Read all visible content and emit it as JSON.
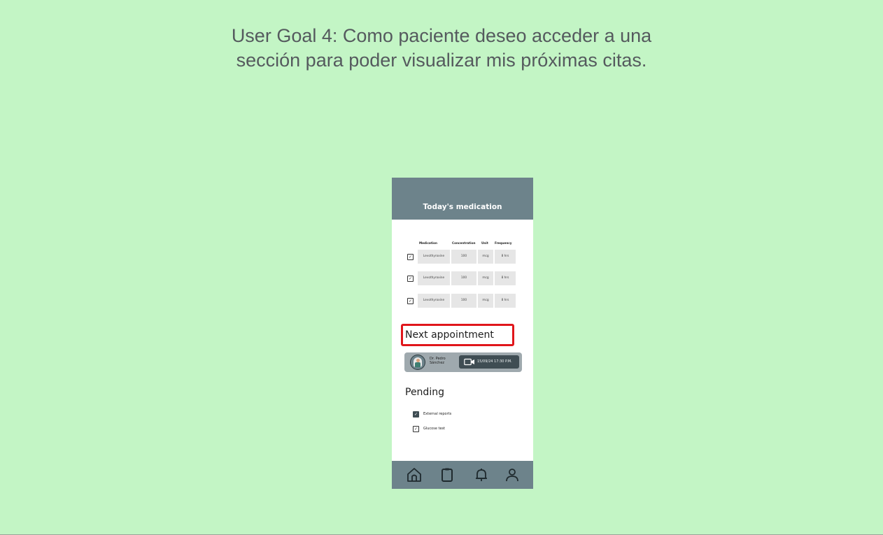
{
  "slide": {
    "title_line1": "User Goal 4: Como paciente deseo acceder a una",
    "title_line2": "sección para poder visualizar mis próximas citas."
  },
  "phone": {
    "header_title": "Today's medication",
    "medication_table": {
      "headers": [
        "Medication",
        "Concentration",
        "Unit",
        "Frequency"
      ],
      "rows": [
        {
          "checked": true,
          "medication": "Levothyroxine",
          "concentration": "100",
          "unit": "mcg",
          "frequency": "8 hrs"
        },
        {
          "checked": true,
          "medication": "Levothyroxine",
          "concentration": "100",
          "unit": "mcg",
          "frequency": "8 hrs"
        },
        {
          "checked": true,
          "medication": "Levothyroxine",
          "concentration": "100",
          "unit": "mcg",
          "frequency": "8 hrs"
        }
      ]
    },
    "appointment": {
      "heading": "Next appointment",
      "doctor_line1": "Dr. Pedro",
      "doctor_line2": "Sánchez",
      "datetime": "15/09/24 17:30 P.M.",
      "icon": "video-camera-icon"
    },
    "pending": {
      "heading": "Pending",
      "items": [
        {
          "label": "External reports",
          "checked": true,
          "style": "filled"
        },
        {
          "label": "Glucose test",
          "checked": true,
          "style": "outline"
        }
      ]
    },
    "nav": {
      "icons": [
        "home-icon",
        "clipboard-icon",
        "bell-icon",
        "profile-icon"
      ]
    }
  },
  "colors": {
    "background": "#c3f5c5",
    "header": "#6d838b",
    "highlight": "#e0161b",
    "pill": "#3f4d53"
  }
}
